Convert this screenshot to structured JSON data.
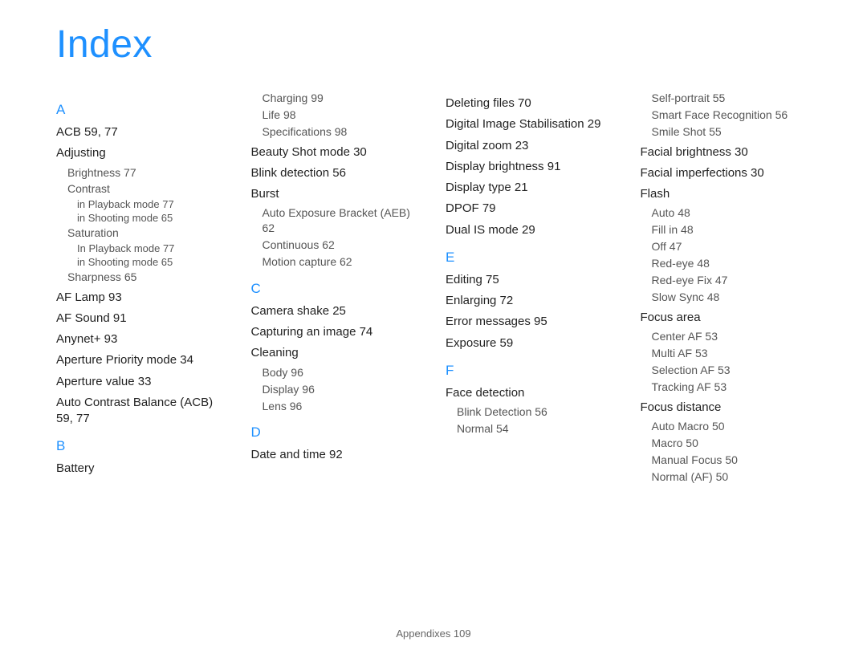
{
  "title": "Index",
  "footer": "Appendixes  109",
  "col1": {
    "letterA": "A",
    "acb": "ACB  59, 77",
    "adjusting": "Adjusting",
    "brightness": "Brightness  77",
    "contrast": "Contrast",
    "contrast_playback": "in Playback mode  77",
    "contrast_shooting": "in Shooting mode  65",
    "saturation": "Saturation",
    "sat_playback": "In Playback mode  77",
    "sat_shooting": "in Shooting mode  65",
    "sharpness": "Sharpness  65",
    "aflamp": "AF Lamp  93",
    "afsound": "AF Sound  91",
    "anynet": "Anynet+  93",
    "ap_priority": "Aperture Priority mode  34",
    "ap_value": "Aperture value  33",
    "acb_full": "Auto Contrast Balance (ACB)  59, 77",
    "letterB": "B",
    "battery": "Battery"
  },
  "col2": {
    "charging": "Charging  99",
    "life": "Life  98",
    "specs": "Specifications  98",
    "beauty": "Beauty Shot mode  30",
    "blink": "Blink detection  56",
    "burst": "Burst",
    "aeb": "Auto Exposure Bracket (AEB)  62",
    "continuous": "Continuous  62",
    "motion": "Motion capture  62",
    "letterC": "C",
    "shake": "Camera shake  25",
    "capturing": "Capturing an image  74",
    "cleaning": "Cleaning",
    "body": "Body  96",
    "display": "Display  96",
    "lens": "Lens  96",
    "letterD": "D",
    "datetime": "Date and time  92"
  },
  "col3": {
    "deleting": "Deleting files  70",
    "dis_full": "Digital Image Stabilisation  29",
    "dzoom": "Digital zoom  23",
    "dbright": "Display brightness  91",
    "dtype": "Display type  21",
    "dpof": "DPOF  79",
    "dualis": "Dual IS mode  29",
    "letterE": "E",
    "editing": "Editing  75",
    "enlarging": "Enlarging  72",
    "errors": "Error messages  95",
    "exposure": "Exposure  59",
    "letterF": "F",
    "facedet": "Face detection",
    "fd_blink": "Blink Detection  56",
    "fd_normal": "Normal  54"
  },
  "col4": {
    "selfp": "Self-portrait  55",
    "smartface": "Smart Face Recognition  56",
    "smile": "Smile Shot  55",
    "facialb": "Facial brightness  30",
    "faciali": "Facial imperfections  30",
    "flash": "Flash",
    "fl_auto": "Auto  48",
    "fl_fill": "Fill in  48",
    "fl_off": "Off  47",
    "fl_redeye": "Red-eye  48",
    "fl_redeyefix": "Red-eye Fix  47",
    "fl_slow": "Slow Sync  48",
    "focusarea": "Focus area",
    "fa_center": "Center AF  53",
    "fa_multi": "Multi AF  53",
    "fa_sel": "Selection AF  53",
    "fa_track": "Tracking AF  53",
    "focusdist": "Focus distance",
    "fd_auto": "Auto Macro  50",
    "fd_macro": "Macro  50",
    "fd_manual": "Manual Focus  50",
    "fd_norm": "Normal (AF)  50"
  }
}
